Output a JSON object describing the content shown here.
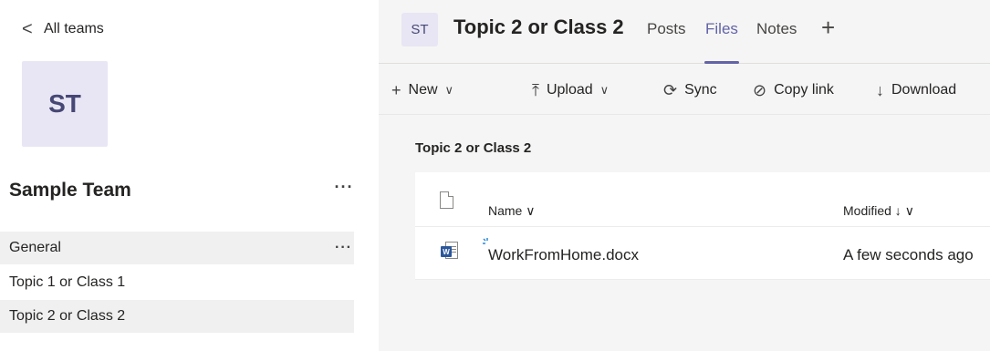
{
  "sidebar": {
    "back_chevron": "<",
    "back_label": "All teams",
    "team_initials": "ST",
    "team_name": "Sample Team",
    "more": "···",
    "channels": [
      {
        "label": "General",
        "more": "···"
      },
      {
        "label": "Topic 1 or Class 1"
      },
      {
        "label": "Topic 2 or Class 2"
      }
    ]
  },
  "header": {
    "channel_initials": "ST",
    "channel_name": "Topic 2 or Class 2",
    "tabs": [
      {
        "label": "Posts"
      },
      {
        "label": "Files"
      },
      {
        "label": "Notes"
      }
    ],
    "add_tab": "+"
  },
  "toolbar": {
    "new": {
      "icon": "plus-icon",
      "glyph": "+",
      "label": "New",
      "dropdown": "∨"
    },
    "upload": {
      "icon": "upload-icon",
      "glyph": "⤒",
      "label": "Upload",
      "dropdown": "∨"
    },
    "sync": {
      "icon": "sync-icon",
      "glyph": "⟳",
      "label": "Sync"
    },
    "copy_link": {
      "icon": "link-icon",
      "glyph": "⊘",
      "label": "Copy link"
    },
    "download": {
      "icon": "download-icon",
      "glyph": "↓",
      "label": "Download"
    }
  },
  "files": {
    "breadcrumb": "Topic 2 or Class 2",
    "columns": {
      "name": "Name ∨",
      "modified": "Modified ↓ ∨"
    },
    "rows": [
      {
        "name": "WorkFromHome.docx",
        "modified": "A few seconds ago",
        "type": "word-icon",
        "badge": "W"
      }
    ]
  },
  "colors": {
    "accent": "#6264a7",
    "avatar_bg": "#e8e6f4",
    "avatar_text": "#464775",
    "word_blue": "#2b579a",
    "pane_bg": "#f5f5f5",
    "selected_bg": "#f0f0f0"
  }
}
